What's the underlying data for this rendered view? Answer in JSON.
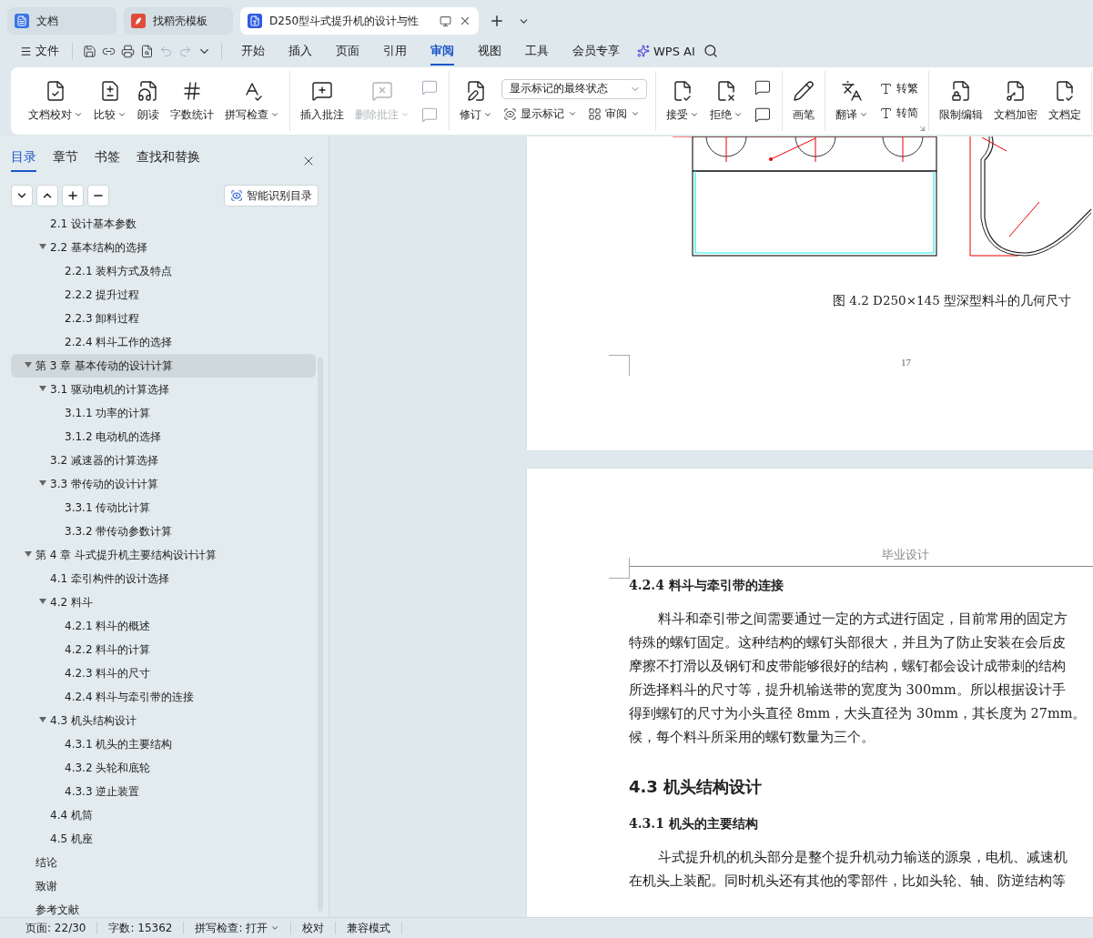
{
  "browser_tabs": [
    {
      "kind": "docs",
      "label": "文档",
      "selected": false
    },
    {
      "kind": "template",
      "label": "找稻壳模板",
      "selected": false
    },
    {
      "kind": "writer",
      "label": "D250型斗式提升机的设计与性",
      "selected": true
    }
  ],
  "menu": {
    "file": "文件",
    "tabs": [
      {
        "label": "开始",
        "selected": false
      },
      {
        "label": "插入",
        "selected": false
      },
      {
        "label": "页面",
        "selected": false
      },
      {
        "label": "引用",
        "selected": false
      },
      {
        "label": "审阅",
        "selected": true
      },
      {
        "label": "视图",
        "selected": false
      },
      {
        "label": "工具",
        "selected": false
      },
      {
        "label": "会员专享",
        "selected": false
      }
    ],
    "ai": "WPS AI"
  },
  "ribbon": {
    "groups": [
      {
        "items": [
          {
            "kind": "large",
            "label": "文档校对",
            "dropdown": true
          },
          {
            "kind": "large",
            "label": "比较",
            "dropdown": true
          },
          {
            "kind": "large",
            "label": "朗读",
            "dropdown": false
          },
          {
            "kind": "large",
            "label": "字数统计",
            "dropdown": false
          },
          {
            "kind": "large",
            "label": "拼写检查",
            "dropdown": true
          }
        ]
      },
      {
        "items": [
          {
            "kind": "large",
            "label": "插入批注",
            "dropdown": false,
            "disabled": false
          },
          {
            "kind": "large",
            "label": "删除批注",
            "dropdown": true,
            "disabled": true
          },
          {
            "kind": "column",
            "items": [
              {
                "kind": "icon",
                "disabled": true
              },
              {
                "kind": "icon",
                "disabled": true
              }
            ]
          }
        ]
      },
      {
        "items": [
          {
            "kind": "large",
            "label": "修订",
            "dropdown": true
          },
          {
            "kind": "column",
            "items": [
              {
                "kind": "select",
                "value": "显示标记的最终状态"
              },
              {
                "kind": "row",
                "items": [
                  {
                    "kind": "small",
                    "label": "显示标记",
                    "dropdown": true
                  },
                  {
                    "kind": "small",
                    "label": "审阅",
                    "dropdown": true
                  }
                ]
              }
            ]
          }
        ]
      },
      {
        "items": [
          {
            "kind": "large",
            "label": "接受",
            "dropdown": true
          },
          {
            "kind": "large",
            "label": "拒绝",
            "dropdown": true
          },
          {
            "kind": "column",
            "items": [
              {
                "kind": "icon",
                "disabled": false
              },
              {
                "kind": "icon",
                "disabled": false
              }
            ]
          }
        ]
      },
      {
        "items": [
          {
            "kind": "large",
            "label": "画笔",
            "dropdown": false
          }
        ]
      },
      {
        "launcher": true,
        "items": [
          {
            "kind": "large",
            "label": "翻译",
            "dropdown": true
          },
          {
            "kind": "column",
            "items": [
              {
                "kind": "small",
                "label": "转繁",
                "dropdown": false
              },
              {
                "kind": "small",
                "label": "转简",
                "dropdown": false
              }
            ]
          }
        ]
      },
      {
        "items": [
          {
            "kind": "large",
            "label": "限制编辑",
            "dropdown": false
          },
          {
            "kind": "large",
            "label": "文档加密",
            "dropdown": false
          },
          {
            "kind": "large",
            "label": "文档定",
            "dropdown": false
          }
        ]
      }
    ]
  },
  "sidebar": {
    "tabs": [
      {
        "label": "目录",
        "selected": true
      },
      {
        "label": "章节",
        "selected": false
      },
      {
        "label": "书签",
        "selected": false
      },
      {
        "label": "查找和替换",
        "selected": false
      }
    ],
    "smart_button": "智能识别目录",
    "toc": [
      {
        "children": [
          {
            "label": "2.1 设计基本参数",
            "selected": false
          },
          {
            "label": "2.2 基本结构的选择",
            "selected": false,
            "expanded": true,
            "children": [
              {
                "label": "2.2.1 装料方式及特点",
                "selected": false
              },
              {
                "label": "2.2.2 提升过程",
                "selected": false
              },
              {
                "label": "2.2.3 卸料过程",
                "selected": false
              },
              {
                "label": "2.2.4 料斗工作的选择",
                "selected": false
              }
            ]
          }
        ]
      },
      {
        "label": "第 3 章  基本传动的设计计算",
        "selected": true,
        "expanded": true,
        "children": [
          {
            "label": "3.1 驱动电机的计算选择",
            "selected": false,
            "expanded": true,
            "children": [
              {
                "label": "3.1.1 功率的计算",
                "selected": false
              },
              {
                "label": "3.1.2 电动机的选择",
                "selected": false
              }
            ]
          },
          {
            "label": "3.2 减速器的计算选择",
            "selected": false
          },
          {
            "label": "3.3 带传动的设计计算",
            "selected": false,
            "expanded": true,
            "children": [
              {
                "label": "3.3.1 传动比计算",
                "selected": false
              },
              {
                "label": "3.3.2 带传动参数计算",
                "selected": false
              }
            ]
          }
        ]
      },
      {
        "label": "第 4 章  斗式提升机主要结构设计计算",
        "selected": false,
        "expanded": true,
        "children": [
          {
            "label": "4.1 牵引构件的设计选择",
            "selected": false
          },
          {
            "label": "4.2 料斗",
            "selected": false,
            "expanded": true,
            "children": [
              {
                "label": "4.2.1 料斗的概述",
                "selected": false
              },
              {
                "label": "4.2.2 料斗的计算",
                "selected": false
              },
              {
                "label": "4.2.3 料斗的尺寸",
                "selected": false
              },
              {
                "label": "4.2.4 料斗与牵引带的连接",
                "selected": false
              }
            ]
          },
          {
            "label": "4.3 机头结构设计",
            "selected": false,
            "expanded": true,
            "children": [
              {
                "label": "4.3.1 机头的主要结构",
                "selected": false
              },
              {
                "label": "4.3.2 头轮和底轮",
                "selected": false
              },
              {
                "label": "4.3.3 逆止装置",
                "selected": false
              }
            ]
          },
          {
            "label": "4.4 机筒",
            "selected": false
          },
          {
            "label": "4.5 机座",
            "selected": false
          }
        ]
      },
      {
        "label": "结论",
        "selected": false
      },
      {
        "label": "致谢",
        "selected": false
      },
      {
        "label": "参考文献",
        "selected": false
      }
    ]
  },
  "document": {
    "page1": {
      "caption": "图 4.2 D250×145 型深型料斗的几何尺寸",
      "page_number": "17"
    },
    "page2": {
      "header": "毕业设计",
      "blocks": [
        {
          "kind": "h3",
          "text": "4.2.4 料斗与牵引带的连接"
        },
        {
          "kind": "para",
          "lines": [
            "料斗和牵引带之间需要通过一定的方式进行固定，目前常用的固定方",
            "特殊的螺钉固定。这种结构的螺钉头部很大，并且为了防止安装在会后皮",
            "摩擦不打滑以及钢钉和皮带能够很好的结构，螺钉都会设计成带刺的结构",
            "所选择料斗的尺寸等，提升机输送带的宽度为 300mm。所以根据设计手",
            "得到螺钉的尺寸为小头直径 8mm，大头直径为 30mm，其长度为 27mm。",
            "候，每个料斗所采用的螺钉数量为三个。"
          ]
        },
        {
          "kind": "h2",
          "text": "4.3 机头结构设计"
        },
        {
          "kind": "h3",
          "text": "4.3.1 机头的主要结构"
        },
        {
          "kind": "para",
          "lines": [
            "斗式提升机的机头部分是整个提升机动力输送的源泉，电机、减速机",
            "在机头上装配。同时机头还有其他的零部件，比如头轮、轴、防逆结构等"
          ]
        }
      ]
    }
  },
  "status_bar": [
    {
      "kind": "text",
      "label": "页面: 22/30"
    },
    {
      "kind": "text",
      "label": "字数: 15362"
    },
    {
      "kind": "dropdown",
      "label": "拼写检查: 打开"
    },
    {
      "kind": "text",
      "label": "校对"
    },
    {
      "kind": "text",
      "label": "兼容模式"
    }
  ]
}
